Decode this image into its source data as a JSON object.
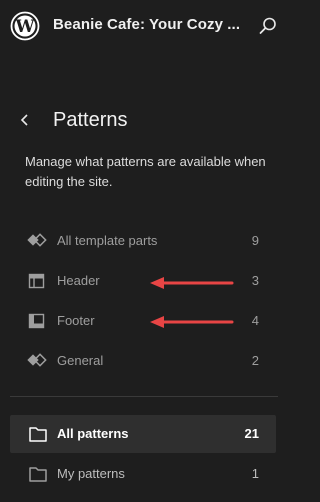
{
  "topbar": {
    "site_title": "Beanie Cafe: Your Cozy ...",
    "logo_icon": "wordpress-logo-icon",
    "search_icon": "search-icon"
  },
  "header": {
    "back_icon": "chevron-left-icon",
    "title": "Patterns",
    "description": "Manage what patterns are available when editing the site."
  },
  "template_parts": [
    {
      "label": "All template parts",
      "count": "9",
      "icon": "blocks-icon"
    },
    {
      "label": "Header",
      "count": "3",
      "icon": "header-layout-icon"
    },
    {
      "label": "Footer",
      "count": "4",
      "icon": "footer-layout-icon"
    },
    {
      "label": "General",
      "count": "2",
      "icon": "blocks-icon"
    }
  ],
  "pattern_categories": [
    {
      "label": "All patterns",
      "count": "21",
      "icon": "folder-icon",
      "active": true
    },
    {
      "label": "My patterns",
      "count": "1",
      "icon": "folder-icon",
      "active": false
    }
  ],
  "annotations": {
    "arrow_color": "#e84545"
  },
  "colors": {
    "background": "#1e1e1e",
    "active_row": "#2f2f2f",
    "muted_text": "#9e9e9e"
  }
}
